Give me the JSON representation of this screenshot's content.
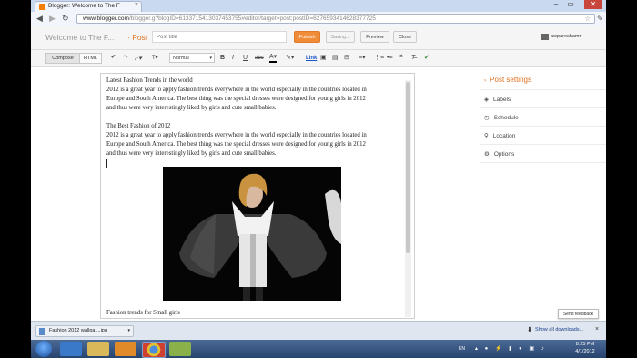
{
  "browser": {
    "tab_title": "Blogger: Welcome to The F",
    "tab_close": "×",
    "url_host": "www.blogger.com",
    "url_path": "/blogger.g?blogID=6133715413037453755#editor/target=post;postID=6276593414628377725",
    "window_buttons": [
      "–",
      "▭",
      "✕"
    ]
  },
  "blogger": {
    "blog_name": "Welcome to The F...",
    "section": "· Post",
    "post_title_placeholder": "Post title",
    "buttons": {
      "publish": "Publish",
      "saving": "Saving...",
      "preview": "Preview",
      "close": "Close"
    },
    "username": "awparesham▾"
  },
  "toolbar": {
    "compose": "Compose",
    "html": "HTML",
    "format": "Normal",
    "link": "Link"
  },
  "editor": {
    "heading1": "Latest Fashion Trends in the world",
    "para1_l1": "2012 is a great year to apply fashion trends everywhere in the world especially in the countries located in",
    "para1_l2": "Europe and South America. The best thing was the special dresses were designed for young girls in 2012",
    "para1_l3": "and thus were very interestingly liked by girls and cute small babies.",
    "heading2": "The Best Fashion of 2012",
    "para2_l1": "2012 is a great year to apply fashion trends everywhere in the world especially in the countries located in",
    "para2_l2": "Europe and South America. The best thing was the special dresses were designed for young girls in 2012",
    "para2_l3": "and thus were very interestingly liked by girls and cute small babies.",
    "closing": "Fashion trends for Small girls"
  },
  "post_settings": {
    "title": "Post settings",
    "items": [
      {
        "label": "Labels",
        "icon": "tag-icon"
      },
      {
        "label": "Schedule",
        "icon": "clock-icon"
      },
      {
        "label": "Location",
        "icon": "pin-icon"
      },
      {
        "label": "Options",
        "icon": "gear-icon"
      }
    ]
  },
  "feedback": "Send feedback",
  "downloads": {
    "item": "Fashion 2012 wallpa....jpg",
    "show_all": "Show all downloads...",
    "close": "×"
  },
  "taskbar": {
    "lang": "EN",
    "time": "8:25 PM",
    "date": "4/1/2012"
  },
  "colors": {
    "accent": "#dd7020",
    "publish": "#f08c38",
    "link": "#1a56c8"
  }
}
